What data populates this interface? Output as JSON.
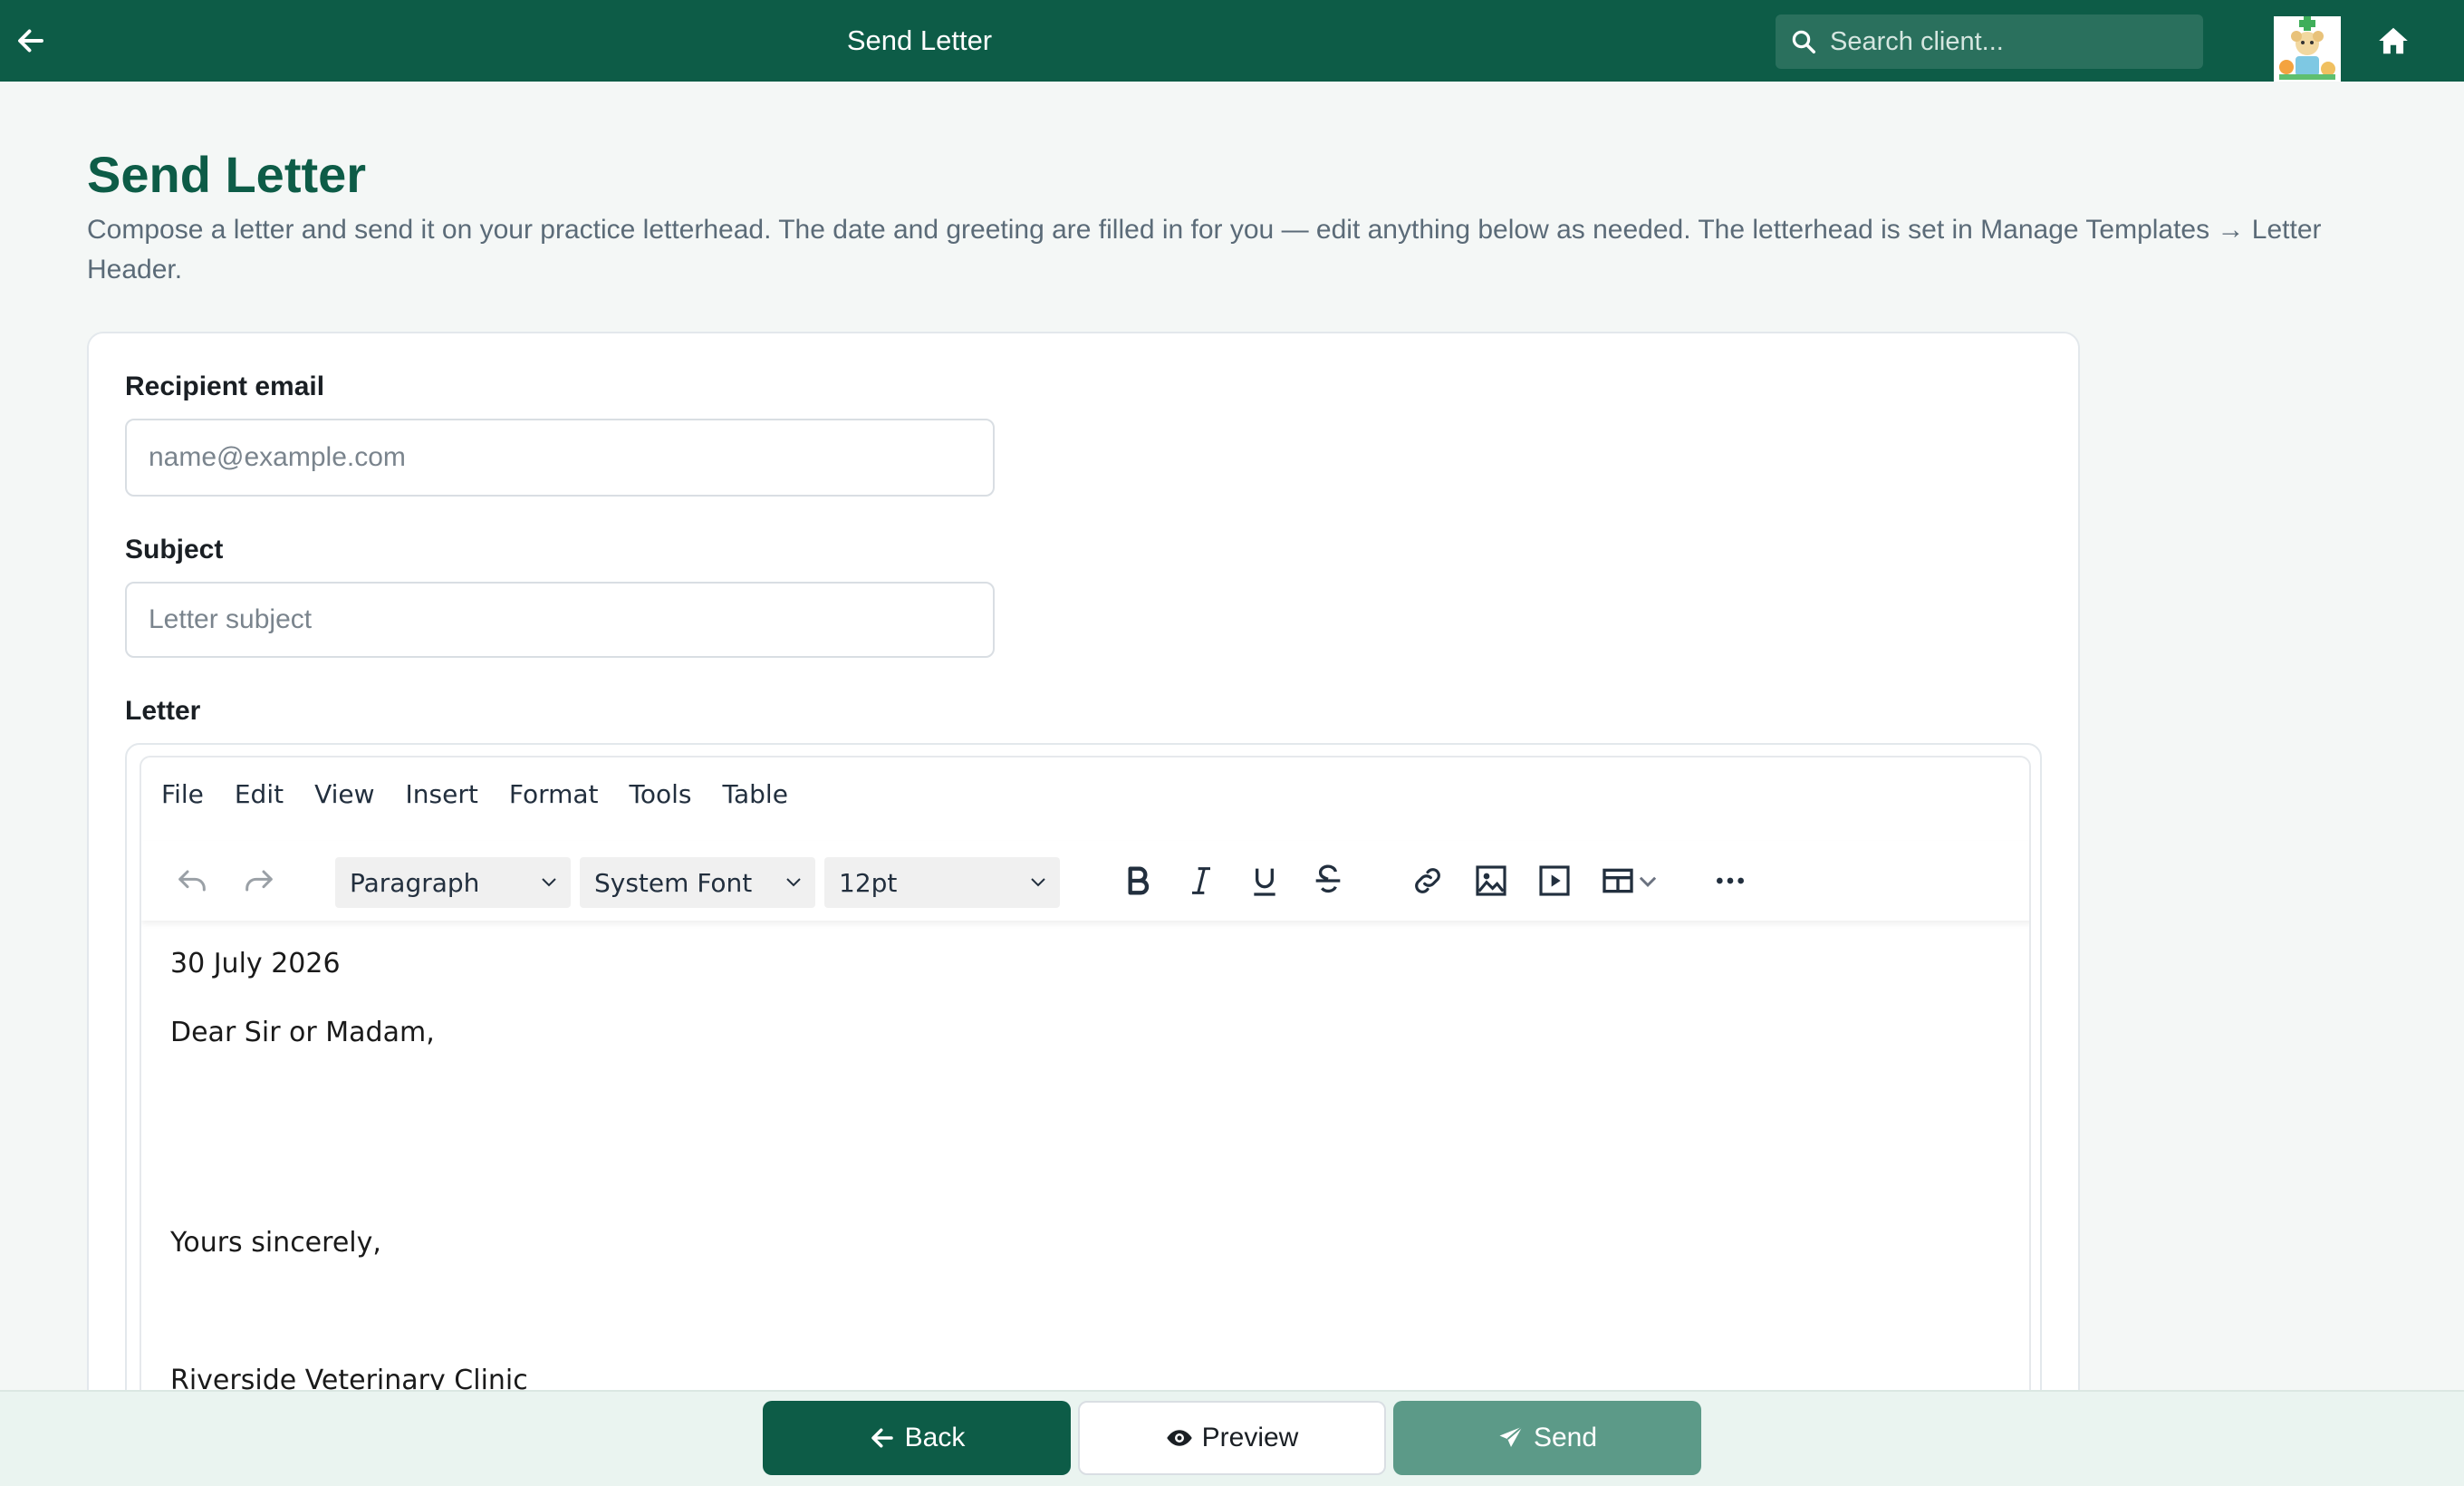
{
  "topbar": {
    "title": "Send Letter",
    "search_placeholder": "Search client..."
  },
  "page": {
    "title": "Send Letter",
    "description": "Compose a letter and send it on your practice letterhead. The date and greeting are filled in for you — edit anything below as needed. The letterhead is set in Manage Templates → Letter Header."
  },
  "form": {
    "recipient_label": "Recipient email",
    "recipient_placeholder": "name@example.com",
    "recipient_value": "",
    "subject_label": "Subject",
    "subject_placeholder": "Letter subject",
    "subject_value": "",
    "letter_label": "Letter"
  },
  "editor": {
    "menus": [
      "File",
      "Edit",
      "View",
      "Insert",
      "Format",
      "Tools",
      "Table"
    ],
    "block_format": "Paragraph",
    "font_family": "System Font",
    "font_size": "12pt",
    "content": {
      "date": "30 July 2026",
      "greeting": "Dear Sir or Madam,",
      "closing": "Yours sincerely,",
      "signature": "Riverside Veterinary Clinic"
    }
  },
  "actions": {
    "back": "Back",
    "preview": "Preview",
    "send": "Send"
  },
  "colors": {
    "brand": "#0d5c47",
    "send_disabled": "#5c9a88"
  }
}
